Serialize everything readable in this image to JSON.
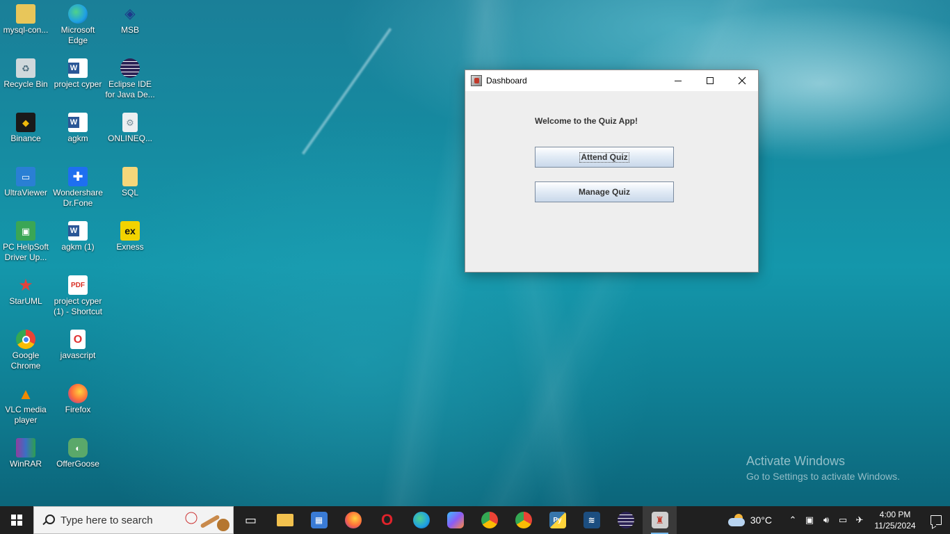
{
  "desktop": {
    "icons": [
      {
        "label": "mysql-con...",
        "icon": "folder-icon",
        "color": "#e8c65a"
      },
      {
        "label": "Microsoft Edge",
        "icon": "edge-icon",
        "color": "#1fa0e3"
      },
      {
        "label": "MSB",
        "icon": "msb-icon",
        "color": "#1e3a8a"
      },
      {
        "label": "Recycle Bin",
        "icon": "recycle-bin-icon",
        "color": "#cfd8dc"
      },
      {
        "label": "project cyper",
        "icon": "word-doc-icon",
        "color": "#2b5797"
      },
      {
        "label": "Eclipse IDE for Java De...",
        "icon": "eclipse-icon",
        "color": "#2c2255"
      },
      {
        "label": "Binance",
        "icon": "binance-icon",
        "color": "#f0b90b"
      },
      {
        "label": "agkm",
        "icon": "word-doc-icon",
        "color": "#2b5797"
      },
      {
        "label": "ONLINEQ...",
        "icon": "file-icon",
        "color": "#e0e0e0"
      },
      {
        "label": "UltraViewer",
        "icon": "ultraviewer-icon",
        "color": "#2a7fd4"
      },
      {
        "label": "Wondershare Dr.Fone",
        "icon": "drfone-icon",
        "color": "#1e6ff0"
      },
      {
        "label": "SQL",
        "icon": "folder-icon",
        "color": "#e8c65a"
      },
      {
        "label": "PC HelpSoft Driver Up...",
        "icon": "pchelpsoft-icon",
        "color": "#3aa655"
      },
      {
        "label": "agkm (1)",
        "icon": "word-doc-icon",
        "color": "#2b5797"
      },
      {
        "label": "Exness",
        "icon": "exness-icon",
        "color": "#f2d300"
      },
      {
        "label": "StarUML",
        "icon": "staruml-icon",
        "color": "#e2433b"
      },
      {
        "label": "project cyper (1) - Shortcut",
        "icon": "pdf-icon",
        "color": "#d93025"
      },
      {
        "label": "Google Chrome",
        "icon": "chrome-icon",
        "color": "#34a853"
      },
      {
        "label": "javascript",
        "icon": "opera-file-icon",
        "color": "#e03030"
      },
      {
        "label": "VLC media player",
        "icon": "vlc-icon",
        "color": "#f08a00"
      },
      {
        "label": "Firefox",
        "icon": "firefox-icon",
        "color": "#ff7139"
      },
      {
        "label": "WinRAR",
        "icon": "winrar-icon",
        "color": "#8e3f9e"
      },
      {
        "label": "OfferGoose",
        "icon": "offergoose-icon",
        "color": "#5aa86a"
      }
    ]
  },
  "window": {
    "title": "Dashboard",
    "welcome": "Welcome to the Quiz App!",
    "attend_label": "Attend Quiz",
    "manage_label": "Manage Quiz"
  },
  "watermark": {
    "line1": "Activate Windows",
    "line2": "Go to Settings to activate Windows."
  },
  "taskbar": {
    "search_placeholder": "Type here to search",
    "apps": [
      {
        "icon": "task-view-icon",
        "color": "#202020",
        "glyph": "▭"
      },
      {
        "icon": "file-explorer-icon",
        "color": "#f2c14e",
        "glyph": ""
      },
      {
        "icon": "microsoft-store-icon",
        "color": "#3a7bd5",
        "glyph": "▦"
      },
      {
        "icon": "firefox-icon",
        "color": "#ff7139",
        "glyph": ""
      },
      {
        "icon": "opera-icon",
        "color": "#e0232b",
        "glyph": "O"
      },
      {
        "icon": "edge-icon",
        "color": "#1fa0e3",
        "glyph": "e"
      },
      {
        "icon": "copilot-icon",
        "color": "#8a5cf6",
        "glyph": ""
      },
      {
        "icon": "chrome-profile-icon",
        "color": "#34a853",
        "glyph": ""
      },
      {
        "icon": "chrome-icon",
        "color": "#fbbc05",
        "glyph": ""
      },
      {
        "icon": "python-icon",
        "color": "#3776ab",
        "glyph": "Py"
      },
      {
        "icon": "mysql-workbench-icon",
        "color": "#1c4e80",
        "glyph": "≋"
      },
      {
        "icon": "eclipse-icon",
        "color": "#2c2255",
        "glyph": "≡"
      },
      {
        "icon": "java-app-icon",
        "color": "#cfcfcf",
        "glyph": "♜"
      }
    ],
    "weather": "30°C",
    "time": "4:00 PM",
    "date": "11/25/2024"
  }
}
